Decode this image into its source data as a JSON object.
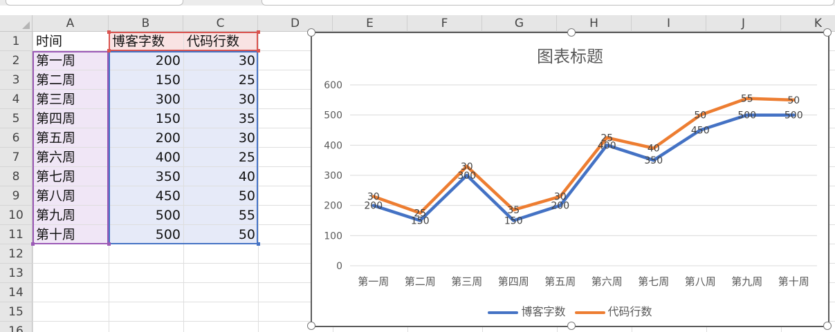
{
  "columns": [
    "A",
    "B",
    "C",
    "D",
    "E",
    "F",
    "G",
    "H",
    "I",
    "J",
    "K"
  ],
  "rows": [
    "1",
    "2",
    "3",
    "4",
    "5",
    "6",
    "7",
    "8",
    "9",
    "10",
    "11",
    "12",
    "13",
    "14",
    "15",
    "16"
  ],
  "sheet": {
    "header": [
      "时间",
      "博客字数",
      "代码行数"
    ],
    "data": [
      [
        "第一周",
        "200",
        "30"
      ],
      [
        "第二周",
        "150",
        "25"
      ],
      [
        "第三周",
        "300",
        "30"
      ],
      [
        "第四周",
        "150",
        "35"
      ],
      [
        "第五周",
        "200",
        "30"
      ],
      [
        "第六周",
        "400",
        "25"
      ],
      [
        "第七周",
        "350",
        "40"
      ],
      [
        "第八周",
        "450",
        "50"
      ],
      [
        "第九周",
        "500",
        "55"
      ],
      [
        "第十周",
        "500",
        "50"
      ]
    ]
  },
  "chart_data": {
    "type": "line",
    "title": "图表标题",
    "categories": [
      "第一周",
      "第二周",
      "第三周",
      "第四周",
      "第五周",
      "第六周",
      "第七周",
      "第八周",
      "第九周",
      "第十周"
    ],
    "stacked": true,
    "series": [
      {
        "name": "博客字数",
        "color": "#4472C4",
        "values": [
          200,
          150,
          300,
          150,
          200,
          400,
          350,
          450,
          500,
          500
        ]
      },
      {
        "name": "代码行数",
        "color": "#ED7D31",
        "values": [
          30,
          25,
          30,
          35,
          30,
          25,
          40,
          50,
          55,
          50
        ]
      }
    ],
    "ylim": [
      0,
      600
    ],
    "yticks": [
      0,
      100,
      200,
      300,
      400,
      500,
      600
    ],
    "grid": true,
    "legend": "bottom",
    "data_labels": true
  }
}
